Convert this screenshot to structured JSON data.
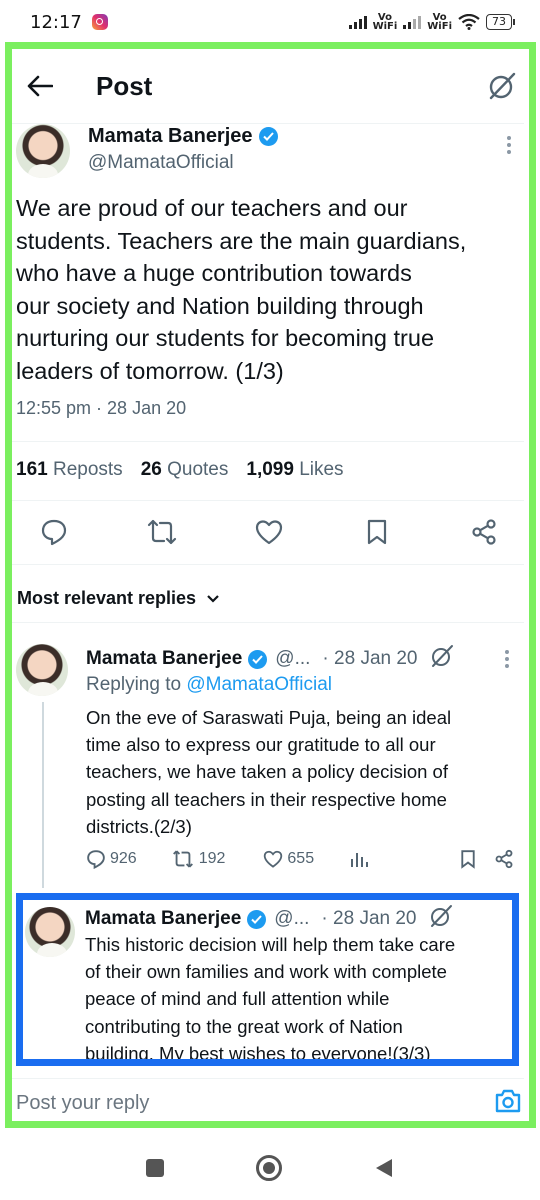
{
  "status_bar": {
    "time": "12:17",
    "net_label_1": "Vo\nWiFi",
    "net_label_2": "Vo\nWiFi",
    "battery": "73"
  },
  "header": {
    "title": "Post",
    "back_icon": "arrow-left-icon",
    "grok_icon": "grok-icon"
  },
  "post": {
    "author_name": "Mamata Banerjee",
    "author_handle": "@MamataOfficial",
    "text": "We are proud of our teachers and our\nstudents. Teachers are the main guardians,\nwho have a huge contribution towards\nour society and Nation building through\nnurturing our students for becoming true\nleaders of tomorrow. (1/3)",
    "timestamp": "12:55 pm · 28 Jan 20",
    "reposts_count": "161",
    "reposts_label": "Reposts",
    "quotes_count": "26",
    "quotes_label": "Quotes",
    "likes_count": "1,099",
    "likes_label": "Likes"
  },
  "replies_filter": {
    "label": "Most relevant replies"
  },
  "replies": [
    {
      "name": "Mamata Banerjee",
      "handle": "@...",
      "date": "· 28 Jan 20",
      "replying_prefix": "Replying to",
      "replying_to": "@MamataOfficial",
      "text": "On the eve of Saraswati Puja, being an ideal\ntime also to express our gratitude to all our\nteachers, we have taken a policy decision of\nposting all teachers in their respective home\ndistricts.(2/3)",
      "comments": "926",
      "reposts": "192",
      "likes": "655"
    },
    {
      "name": "Mamata Banerjee",
      "handle": "@...",
      "date": "· 28 Jan 20",
      "text": "This historic decision will help them take care\nof their own families and work with complete\npeace of mind and full attention while\ncontributing to the great work of Nation\nbuilding. My best wishes to everyone!(3/3)"
    }
  ],
  "reply_bar": {
    "placeholder": "Post your reply"
  },
  "colors": {
    "highlight_green": "#7bef5f",
    "highlight_blue": "#1a6df0",
    "accent": "#1d9bf0"
  }
}
